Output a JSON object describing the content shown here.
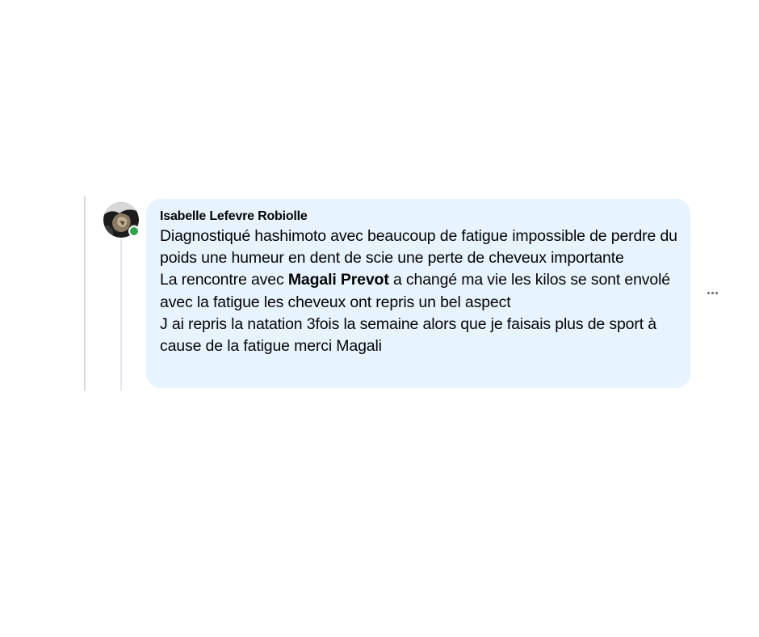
{
  "comment": {
    "author_name": "Isabelle Lefevre Robiolle",
    "online_status": "online",
    "lines": [
      {
        "segments": [
          {
            "text": "Diagnostiqué hashimoto avec beaucoup de fatigue impossible de perdre du poids une humeur en dent de scie une perte de cheveux importante"
          }
        ]
      },
      {
        "segments": [
          {
            "text": "La rencontre avec "
          },
          {
            "text": "Magali Prevot",
            "mention": true
          },
          {
            "text": " a changé ma vie les kilos se sont envolé avec la fatigue les cheveux ont repris un bel aspect"
          }
        ]
      },
      {
        "segments": [
          {
            "text": "J ai repris la natation 3fois la semaine alors que je faisais plus de sport à cause de la fatigue merci Magali"
          }
        ]
      }
    ]
  },
  "actions": {
    "more_icon": "more-horizontal-icon"
  },
  "colors": {
    "bubble_background": "#e7f3ff",
    "text": "#050505",
    "online": "#31a24c",
    "icon_gray": "#65676b"
  }
}
